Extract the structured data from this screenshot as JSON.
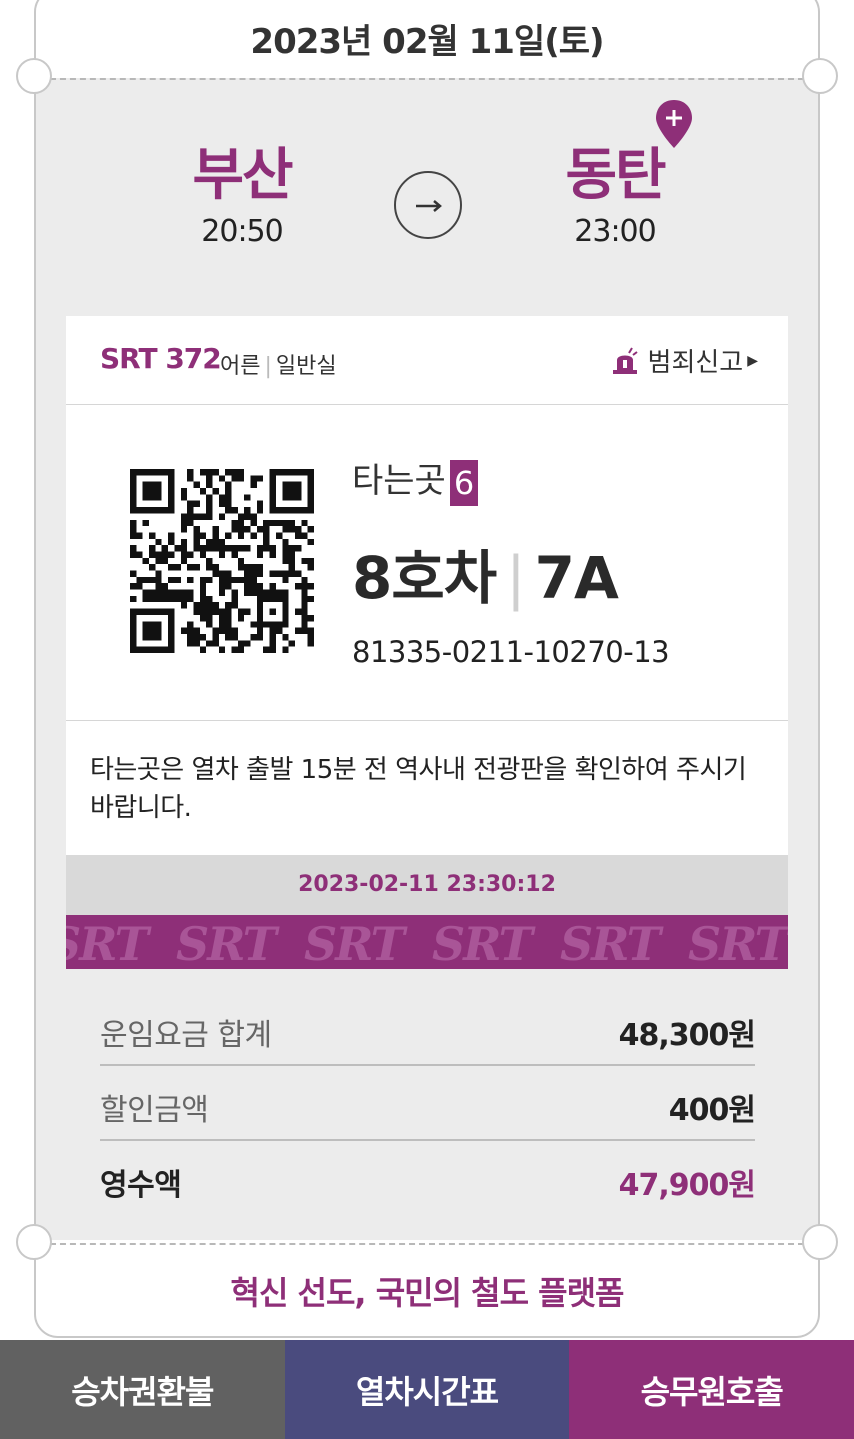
{
  "header": {
    "date": "2023년 02월 11일(토)"
  },
  "route": {
    "departure": {
      "station": "부산",
      "time": "20:50"
    },
    "arrival": {
      "station": "동탄",
      "time": "23:00"
    },
    "arrow_icon": "arrow-right-icon",
    "pin_icon": "map-pin-plus-icon"
  },
  "train": {
    "name": "SRT 372",
    "passenger_type": "어른",
    "car_class": "일반실",
    "report_label": "범죄신고",
    "report_icon": "siren-icon"
  },
  "seat": {
    "platform_label": "타는곳",
    "platform_number": "6",
    "car": "8호차",
    "seat": "7A",
    "ticket_number": "81335-0211-10270-13"
  },
  "notice": "타는곳은 열차 출발 15분 전 역사내 전광판을 확인하여 주시기 바랍니다.",
  "timestamp": "2023-02-11 23:30:12",
  "brand_pattern": "SRT",
  "fares": [
    {
      "label": "운임요금 합계",
      "value": "48,300원"
    },
    {
      "label": "할인금액",
      "value": "400원"
    },
    {
      "label": "영수액",
      "value": "47,900원"
    }
  ],
  "slogan": "혁신 선도, 국민의 철도 플랫폼",
  "bottom_nav": [
    {
      "label": "승차권환불",
      "color": "#616161"
    },
    {
      "label": "열차시간표",
      "color": "#4a4b7e"
    },
    {
      "label": "승무원호출",
      "color": "#8e2f78"
    }
  ],
  "colors": {
    "brand": "#8e2f78",
    "panel": "#ececec"
  }
}
